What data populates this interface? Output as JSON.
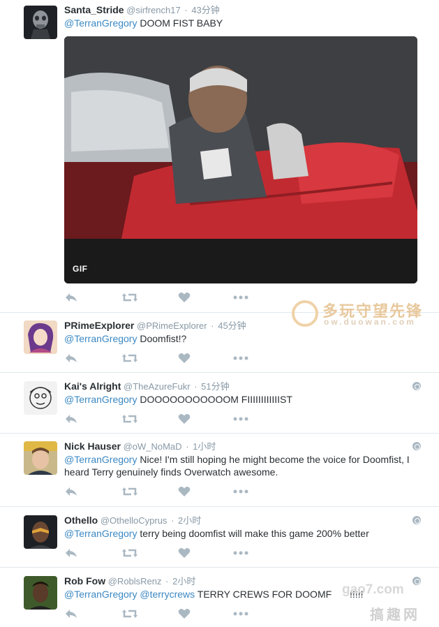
{
  "tweets": [
    {
      "name": "Santa_Stride",
      "handle": "@sirfrench17",
      "time": "43分钟",
      "mention": "@TerranGregory",
      "text": " DOOM FIST BABY",
      "media_badge": "GIF",
      "avatar_icon": "skull-portrait"
    },
    {
      "name": "PRimeExplorer",
      "handle": "@PRimeExplorer",
      "time": "45分钟",
      "mention": "@TerranGregory",
      "text": " Doomfist!?",
      "avatar_icon": "anime-character-portrait"
    },
    {
      "name": "Kai's Alright",
      "handle": "@TheAzureFukr",
      "time": "51分钟",
      "mention": "@TerranGregory",
      "text": " DOOOOOOOOOOOM FIIIIIIIIIIIIST",
      "avatar_icon": "sketch-face-portrait"
    },
    {
      "name": "Nick Hauser",
      "handle": "@oW_NoMaD",
      "time": "1小时",
      "mention": "@TerranGregory",
      "text": " Nice! I'm still hoping he might become the voice for Doomfist, I heard Terry genuinely finds Overwatch awesome.",
      "avatar_icon": "person-photo"
    },
    {
      "name": "Othello",
      "handle": "@OthelloCyprus",
      "time": "2小时",
      "mention": "@TerranGregory",
      "text": " terry being doomfist will make this game 200% better",
      "avatar_icon": "game-character-portrait"
    },
    {
      "name": "Rob Fow",
      "handle": "@RoblsRenz",
      "time": "2小时",
      "mention": "@TerranGregory",
      "mention2": "@terrycrews",
      "text": " TERRY CREWS FOR DOOMF",
      "text_tail": "!!!!!",
      "avatar_icon": "person-photo"
    }
  ],
  "separator": "·",
  "watermarks": {
    "top_title": "多玩守望先锋",
    "top_url": "ow.duowan.com",
    "bottom_url": "gao7.com",
    "bottom_title": "搞趣网"
  },
  "colors": {
    "link": "#3b88c3",
    "muted": "#8899a6",
    "icon": "#aab8c2",
    "divider": "#e1e8ed"
  }
}
